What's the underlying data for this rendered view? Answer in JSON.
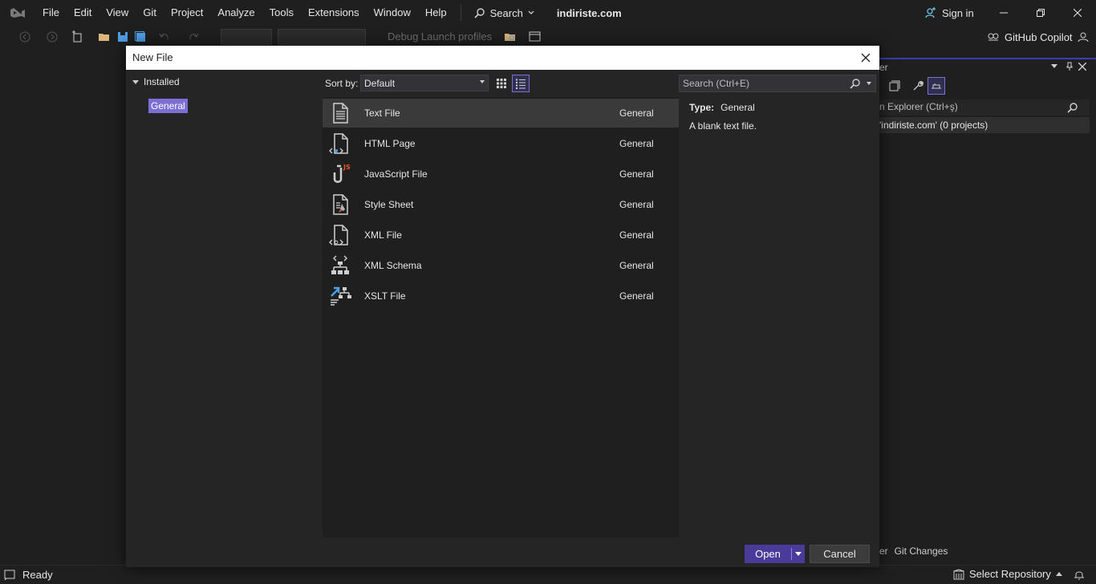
{
  "menubar": {
    "items": [
      "File",
      "Edit",
      "View",
      "Git",
      "Project",
      "Analyze",
      "Tools",
      "Extensions",
      "Window",
      "Help"
    ],
    "search_label": "Search",
    "solution_name": "indiriste.com",
    "signin_label": "Sign in"
  },
  "toolbar": {
    "debug_label": "Debug Launch profiles",
    "copilot_label": "GitHub Copilot"
  },
  "solution_explorer": {
    "title_fragment": "er",
    "search_text": "n Explorer (Ctrl+ş)",
    "solution_row": "'indiriste.com' (0 projects)",
    "tab_fragment": "er",
    "git_changes_label": "Git Changes"
  },
  "statusbar": {
    "ready": "Ready",
    "select_repository": "Select Repository"
  },
  "dialog": {
    "title": "New File",
    "tree": {
      "root_label": "Installed",
      "child_label": "General"
    },
    "sort": {
      "label": "Sort by:",
      "value": "Default"
    },
    "search_placeholder": "Search (Ctrl+E)",
    "items": [
      {
        "name": "Text File",
        "category": "General",
        "icon": "text-file-icon"
      },
      {
        "name": "HTML Page",
        "category": "General",
        "icon": "html-page-icon"
      },
      {
        "name": "JavaScript File",
        "category": "General",
        "icon": "javascript-file-icon"
      },
      {
        "name": "Style Sheet",
        "category": "General",
        "icon": "style-sheet-icon"
      },
      {
        "name": "XML File",
        "category": "General",
        "icon": "xml-file-icon"
      },
      {
        "name": "XML Schema",
        "category": "General",
        "icon": "xml-schema-icon"
      },
      {
        "name": "XSLT File",
        "category": "General",
        "icon": "xslt-file-icon"
      }
    ],
    "details": {
      "type_label": "Type:",
      "type_value": "General",
      "description": "A blank text file."
    },
    "buttons": {
      "open": "Open",
      "cancel": "Cancel"
    }
  }
}
